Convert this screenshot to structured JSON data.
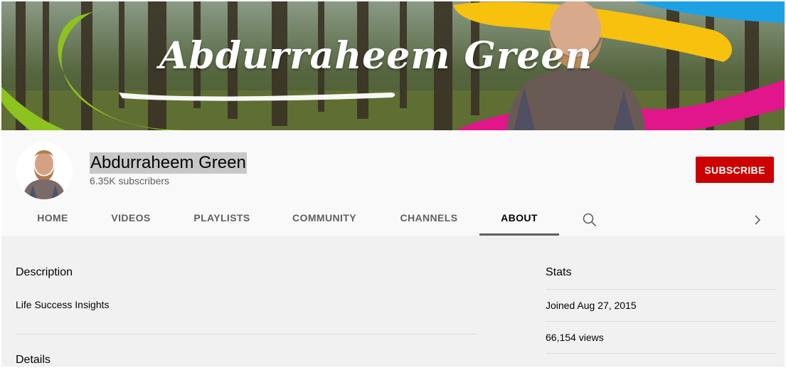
{
  "banner": {
    "title": "Abdurraheem Green"
  },
  "channel": {
    "name": "Abdurraheem Green",
    "subscribers": "6.35K subscribers",
    "subscribe_label": "SUBSCRIBE"
  },
  "tabs": [
    {
      "label": "HOME"
    },
    {
      "label": "VIDEOS"
    },
    {
      "label": "PLAYLISTS"
    },
    {
      "label": "COMMUNITY"
    },
    {
      "label": "CHANNELS"
    },
    {
      "label": "ABOUT",
      "active": true
    }
  ],
  "about": {
    "description_heading": "Description",
    "description_text": "Life Success Insights",
    "details_heading": "Details",
    "stats_heading": "Stats",
    "joined": "Joined Aug 27, 2015",
    "views": "66,154 views"
  },
  "colors": {
    "subscribe_red": "#cc0000",
    "active_tab_underline": "#606060",
    "page_bg": "#f9f9f9",
    "content_bg": "#f1f1f1"
  },
  "icons": {
    "search": "search-icon",
    "next": "chevron-right-icon"
  }
}
